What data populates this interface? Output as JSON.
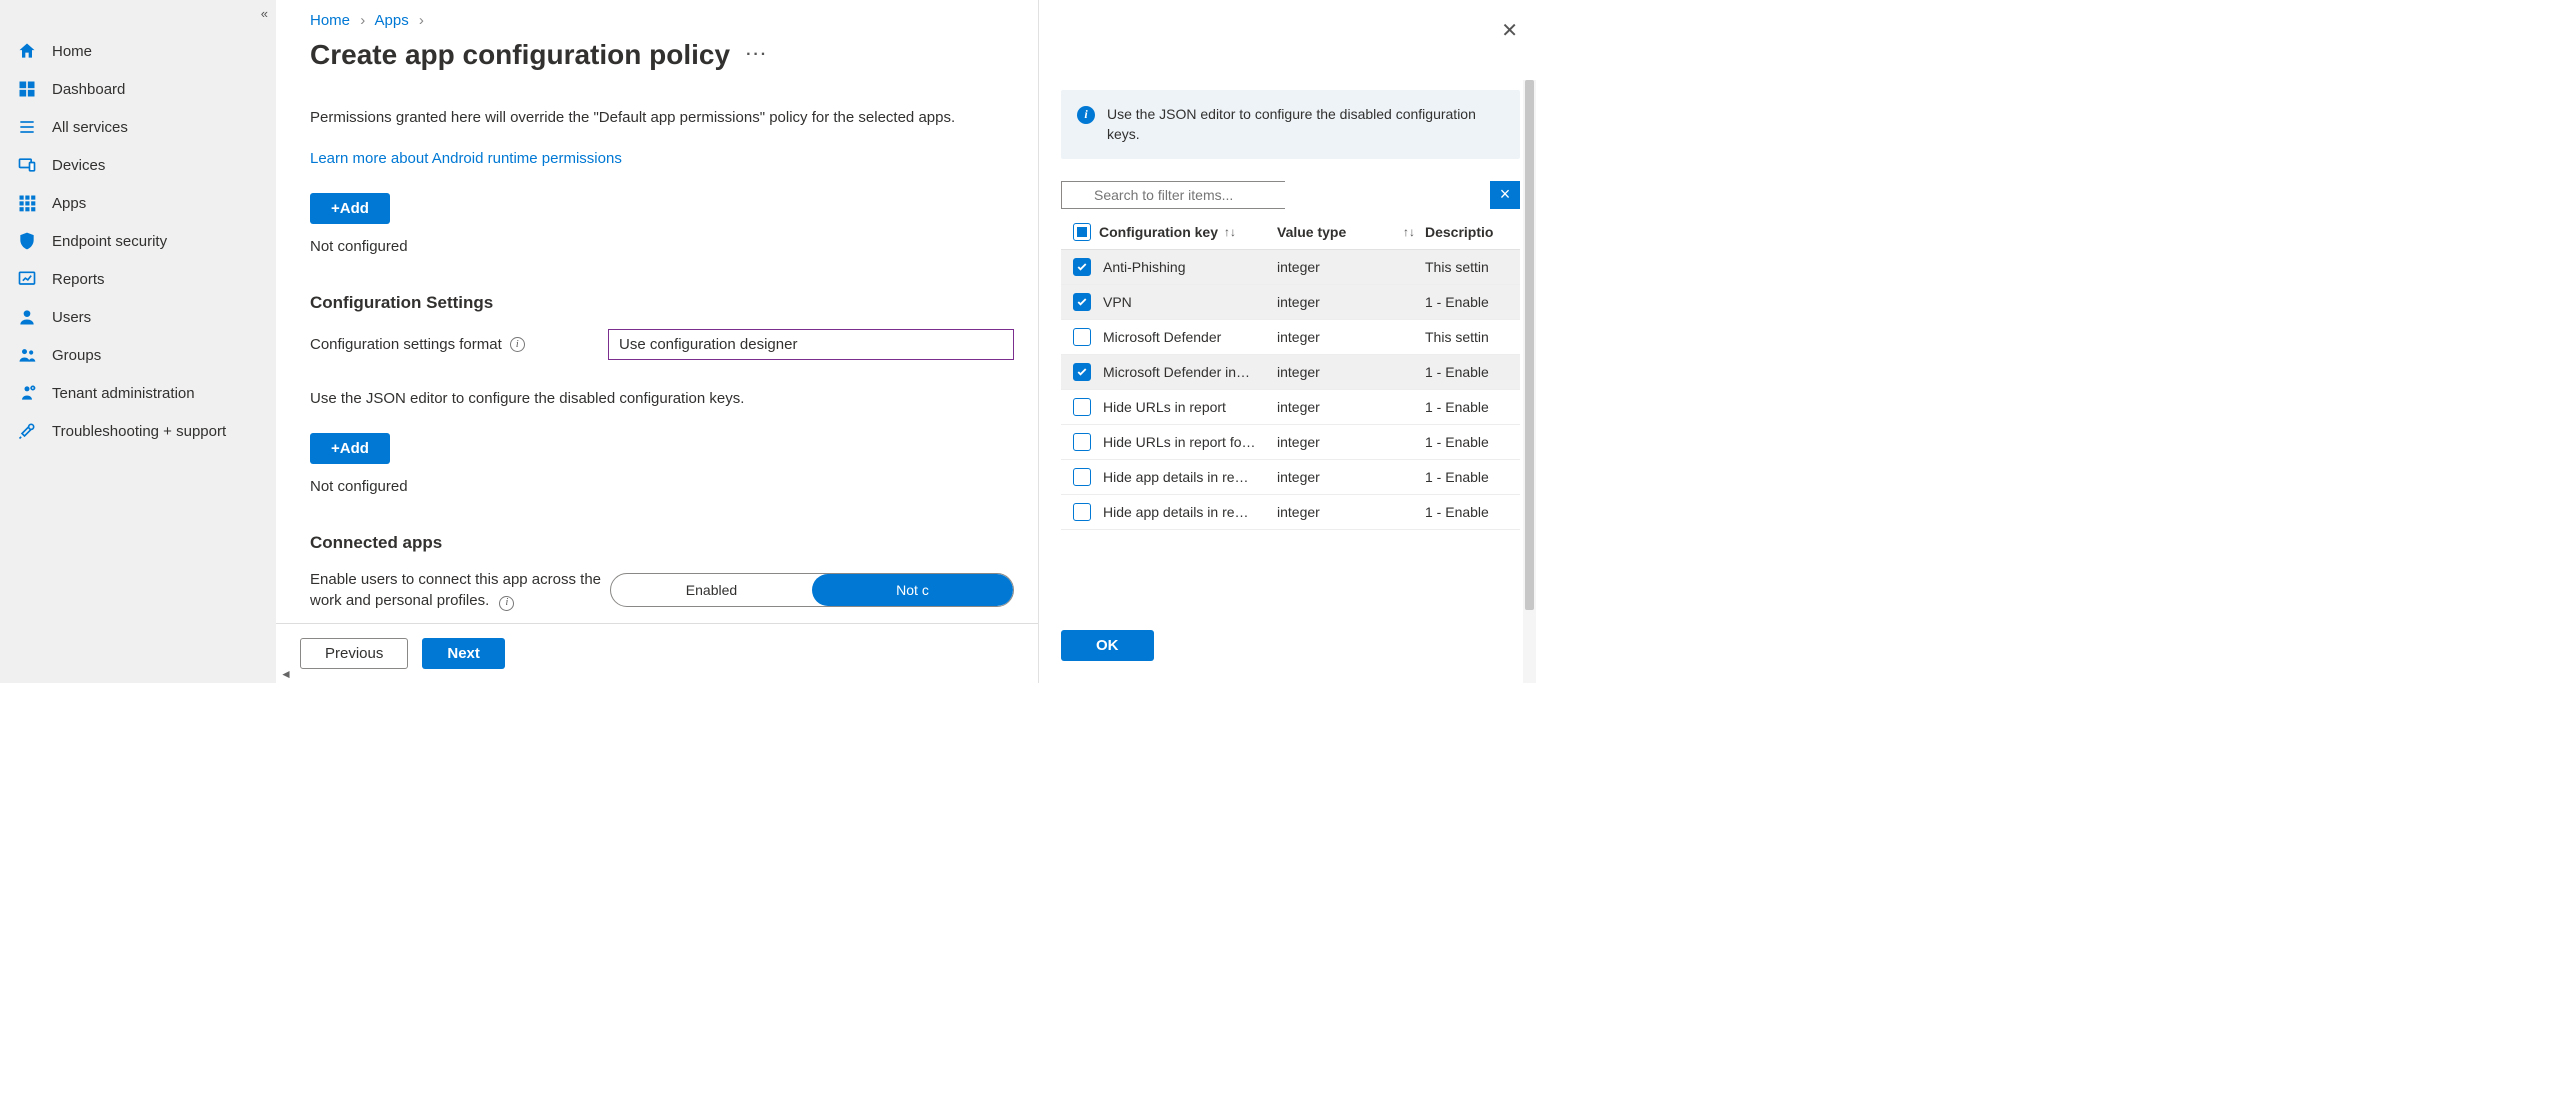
{
  "sidebar": {
    "items": [
      {
        "label": "Home",
        "icon": "home"
      },
      {
        "label": "Dashboard",
        "icon": "dashboard"
      },
      {
        "label": "All services",
        "icon": "list"
      },
      {
        "label": "Devices",
        "icon": "devices"
      },
      {
        "label": "Apps",
        "icon": "apps"
      },
      {
        "label": "Endpoint security",
        "icon": "shield"
      },
      {
        "label": "Reports",
        "icon": "reports"
      },
      {
        "label": "Users",
        "icon": "user"
      },
      {
        "label": "Groups",
        "icon": "group"
      },
      {
        "label": "Tenant administration",
        "icon": "tenant"
      },
      {
        "label": "Troubleshooting + support",
        "icon": "wrench"
      }
    ]
  },
  "breadcrumb": {
    "home": "Home",
    "apps": "Apps"
  },
  "page": {
    "title": "Create app configuration policy",
    "more": "···",
    "permissions_desc": "Permissions granted here will override the \"Default app permissions\" policy for the selected apps.",
    "learn_more": "Learn more about Android runtime permissions",
    "add_label": "+Add",
    "not_configured": "Not configured",
    "config_settings_heading": "Configuration Settings",
    "format_label": "Configuration settings format",
    "format_value": "Use configuration designer",
    "json_hint": "Use the JSON editor to configure the disabled configuration keys.",
    "connected_heading": "Connected apps",
    "connected_label": "Enable users to connect this app across the work and personal profiles.",
    "toggle_enabled": "Enabled",
    "toggle_partial": "Not c",
    "previous": "Previous",
    "next": "Next"
  },
  "panel": {
    "banner": "Use the JSON editor to configure the disabled configuration keys.",
    "search_placeholder": "Search to filter items...",
    "clear": "×",
    "headers": {
      "key": "Configuration key",
      "type": "Value type",
      "desc": "Descriptio"
    },
    "rows": [
      {
        "checked": true,
        "key": "Anti-Phishing",
        "type": "integer",
        "desc": "This settin"
      },
      {
        "checked": true,
        "key": "VPN",
        "type": "integer",
        "desc": "1 - Enable"
      },
      {
        "checked": false,
        "key": "Microsoft Defender",
        "type": "integer",
        "desc": "This settin"
      },
      {
        "checked": true,
        "key": "Microsoft Defender in…",
        "type": "integer",
        "desc": "1 - Enable"
      },
      {
        "checked": false,
        "key": "Hide URLs in report",
        "type": "integer",
        "desc": "1 - Enable"
      },
      {
        "checked": false,
        "key": "Hide URLs in report fo…",
        "type": "integer",
        "desc": "1 - Enable"
      },
      {
        "checked": false,
        "key": "Hide app details in re…",
        "type": "integer",
        "desc": "1 - Enable"
      },
      {
        "checked": false,
        "key": "Hide app details in re…",
        "type": "integer",
        "desc": "1 - Enable"
      }
    ],
    "ok": "OK"
  },
  "colors": {
    "primary": "#0078d4"
  }
}
